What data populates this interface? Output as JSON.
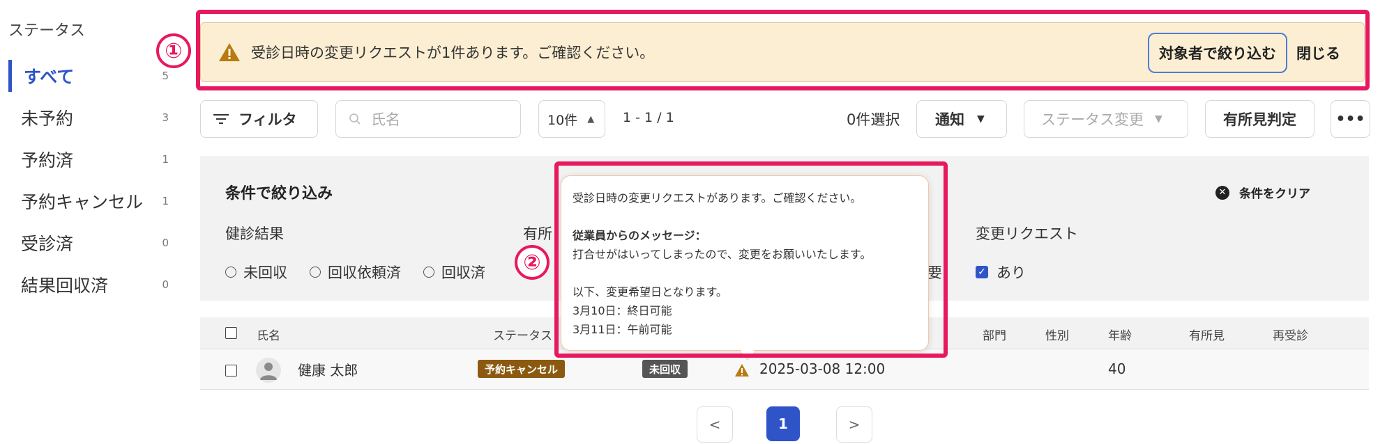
{
  "sidebar": {
    "title": "ステータス",
    "items": [
      {
        "label": "すべて",
        "count": "5"
      },
      {
        "label": "未予約",
        "count": "3"
      },
      {
        "label": "予約済",
        "count": "1"
      },
      {
        "label": "予約キャンセル",
        "count": "1"
      },
      {
        "label": "受診済",
        "count": "0"
      },
      {
        "label": "結果回収済",
        "count": "0"
      }
    ]
  },
  "markers": {
    "one": "①",
    "two": "②"
  },
  "banner": {
    "message": "受診日時の変更リクエストが1件あります。ご確認ください。",
    "narrow_button": "対象者で絞り込む",
    "close_button": "閉じる"
  },
  "toolbar": {
    "filter_label": "フィルタ",
    "search_placeholder": "氏名",
    "per_page": "10件",
    "range": "1 - 1 / 1",
    "selected_count": "0件選択",
    "notify_label": "通知",
    "status_change_placeholder": "ステータス変更",
    "judge_label": "有所見判定",
    "more_label": "•••"
  },
  "filter_panel": {
    "title": "条件で絞り込み",
    "clear_label": "条件をクリア",
    "groups": [
      {
        "label": "健診結果",
        "options": [
          "未回収",
          "回収依頼済",
          "回収済"
        ]
      },
      {
        "label": "有所",
        "options": []
      },
      {
        "label": "変更リクエスト",
        "options": [
          "あり"
        ]
      }
    ],
    "partial_option": "要"
  },
  "table": {
    "headers": {
      "name": "氏名",
      "status": "ステータス",
      "dept": "部門",
      "gender": "性別",
      "age": "年齢",
      "findings": "有所見",
      "recheck": "再受診"
    },
    "rows": [
      {
        "name": "健康 太郎",
        "status_badge": "予約キャンセル",
        "result_badge": "未回収",
        "datetime": "2025-03-08 12:00",
        "age": "40"
      }
    ]
  },
  "pagination": {
    "prev": "<",
    "current": "1",
    "next": ">"
  },
  "tooltip": {
    "line1": "受診日時の変更リクエストがあります。ご確認ください。",
    "heading": "従業員からのメッセージ：",
    "line2": "打合せがはいってしまったので、変更をお願いいたします。",
    "line3": "以下、変更希望日となります。",
    "line4": "3月10日：終日可能",
    "line5": "3月11日：午前可能"
  },
  "colors": {
    "accent": "#2f54c8",
    "highlight": "#e8185f",
    "banner_bg": "#fbeed2",
    "badge_cancel": "#8b5a10",
    "badge_uncollected": "#555555",
    "warn": "#b97a10"
  }
}
